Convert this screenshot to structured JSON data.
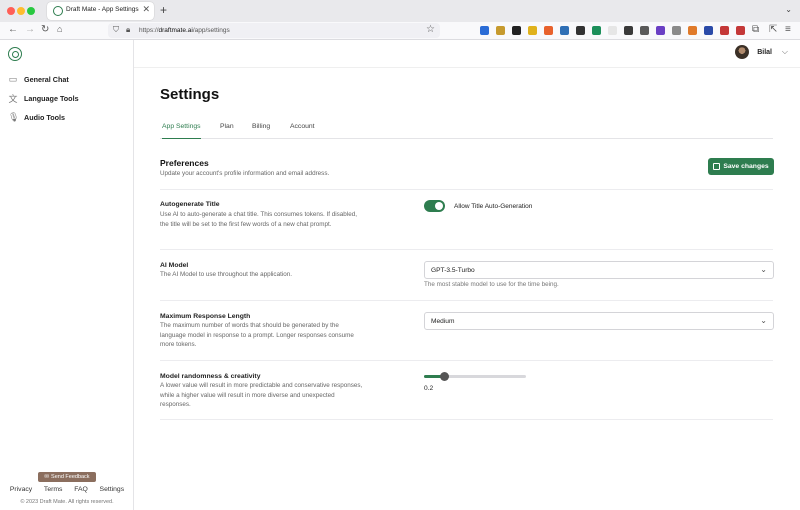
{
  "browser": {
    "tab_title": "Draft Mate - App Settings",
    "tab_close": "✕",
    "new_tab": "+",
    "url_prefix": "https://",
    "url_host": "draftmate.ai",
    "url_path": "/app/settings",
    "extension_colors": [
      "#2b6cd6",
      "#c69a2e",
      "#222222",
      "#e0b21c",
      "#e8612c",
      "#2f6fb5",
      "#333333",
      "#1c8f5a",
      "#e6e6e6",
      "#3a3a3a",
      "#5a5a5a",
      "#6a3fc4",
      "#8a8a8a",
      "#e07a2a",
      "#2a4aa8",
      "#c43838",
      "#c43838"
    ]
  },
  "sidebar": {
    "items": [
      {
        "label": "General Chat",
        "icon": "chat-bubble-icon"
      },
      {
        "label": "Language Tools",
        "icon": "translate-icon"
      },
      {
        "label": "Audio Tools",
        "icon": "microphone-icon"
      }
    ],
    "feedback_label": "Send Feedback",
    "footer_links": [
      "Privacy",
      "Terms",
      "FAQ",
      "Settings"
    ],
    "copyright": "© 2023 Draft Mate. All rights reserved."
  },
  "user": {
    "name": "Bilal"
  },
  "page": {
    "title": "Settings",
    "tabs": [
      "App Settings",
      "Plan",
      "Billing",
      "Account"
    ],
    "active_tab": "App Settings"
  },
  "preferences": {
    "title": "Preferences",
    "subtitle": "Update your account's profile information and email address.",
    "save_label": "Save changes"
  },
  "settings": {
    "autogen": {
      "title": "Autogenerate Title",
      "desc": "Use AI to auto-generate a chat title. This consumes tokens. If disabled, the title will be set to the first few words of a new chat prompt.",
      "toggle_label": "Allow Title Auto-Generation",
      "enabled": true
    },
    "model": {
      "title": "AI Model",
      "desc": "The AI Model to use throughout the application.",
      "value": "GPT-3.5-Turbo",
      "help": "The most stable model to use for the time being."
    },
    "length": {
      "title": "Maximum Response Length",
      "desc": "The maximum number of words that should be generated by the language model in response to a prompt. Longer responses consume more tokens.",
      "value": "Medium"
    },
    "randomness": {
      "title": "Model randomness & creativity",
      "desc": "A lower value will result in more predictable and conservative responses, while a higher value will result in more diverse and unexpected responses.",
      "value": 0.2,
      "value_text": "0.2"
    }
  }
}
